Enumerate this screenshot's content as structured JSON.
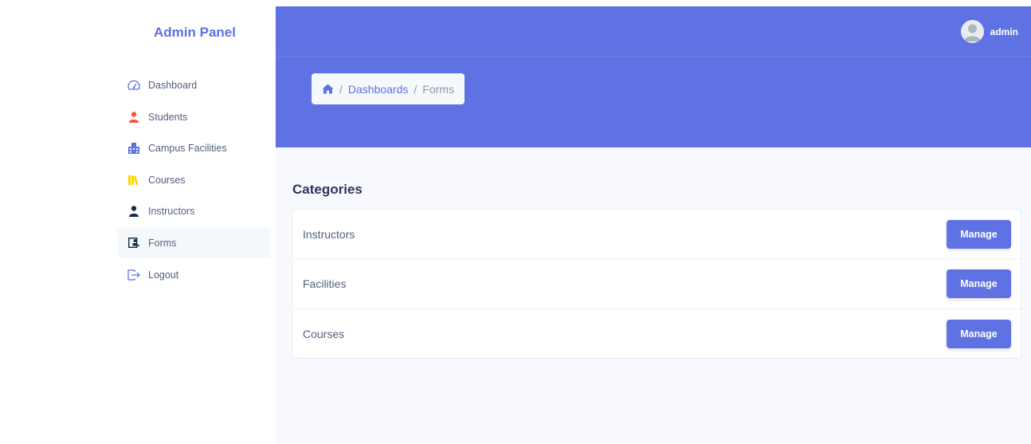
{
  "brand": {
    "title": "Admin Panel"
  },
  "sidebar": {
    "items": [
      {
        "label": "Dashboard",
        "icon": "speedometer-icon",
        "color": "#5e72e4",
        "active": false
      },
      {
        "label": "Students",
        "icon": "person-icon",
        "color": "#f5533d",
        "active": false
      },
      {
        "label": "Campus Facilities",
        "icon": "building-icon",
        "color": "#5e72e4",
        "active": false
      },
      {
        "label": "Courses",
        "icon": "books-icon",
        "color": "#ffd600",
        "active": false
      },
      {
        "label": "Instructors",
        "icon": "person-icon",
        "color": "#172b4d",
        "active": false
      },
      {
        "label": "Forms",
        "icon": "id-card-icon",
        "color": "#172b4d",
        "active": true
      },
      {
        "label": "Logout",
        "icon": "logout-icon",
        "color": "#5e72e4",
        "active": false
      }
    ]
  },
  "header": {
    "user": {
      "name": "admin"
    },
    "breadcrumb": {
      "home_icon": "home-icon",
      "link": "Dashboards",
      "current": "Forms",
      "separator": "/"
    }
  },
  "main": {
    "title": "Categories",
    "rows": [
      {
        "label": "Instructors",
        "button": "Manage"
      },
      {
        "label": "Facilities",
        "button": "Manage"
      },
      {
        "label": "Courses",
        "button": "Manage"
      }
    ]
  },
  "colors": {
    "primary": "#5e72e4",
    "background": "#f8f9fe",
    "text": "#525f7f"
  }
}
